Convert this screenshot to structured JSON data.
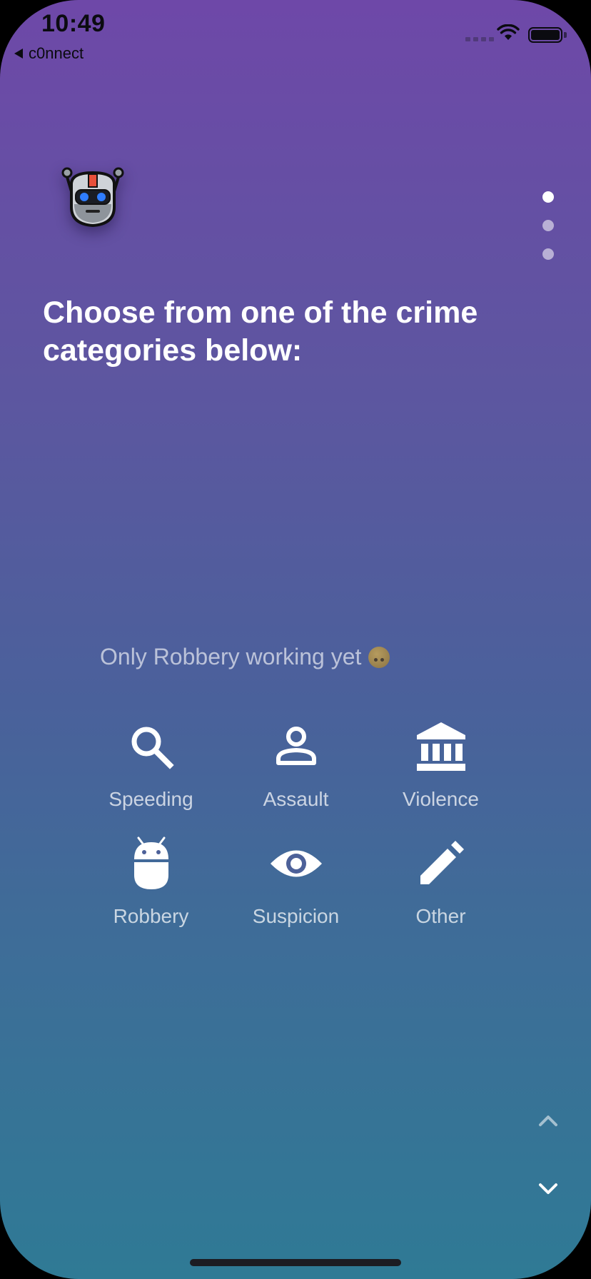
{
  "status_bar": {
    "time": "10:49",
    "back_label": "c0nnect"
  },
  "header": {
    "title": "Choose from one of the crime categories below:"
  },
  "pager": {
    "pages": 3,
    "active_index": 0
  },
  "note": {
    "text": "Only Robbery working yet"
  },
  "categories": [
    {
      "label": "Speeding",
      "icon": "search-icon"
    },
    {
      "label": "Assault",
      "icon": "person-icon"
    },
    {
      "label": "Violence",
      "icon": "institution-icon"
    },
    {
      "label": "Robbery",
      "icon": "android-icon"
    },
    {
      "label": "Suspicion",
      "icon": "eye-icon"
    },
    {
      "label": "Other",
      "icon": "pencil-icon"
    }
  ],
  "colors": {
    "gradient_top": "#6e48a8",
    "gradient_bottom": "#2f7a95",
    "text": "#ffffff",
    "muted_text": "rgba(255,255,255,0.72)"
  }
}
